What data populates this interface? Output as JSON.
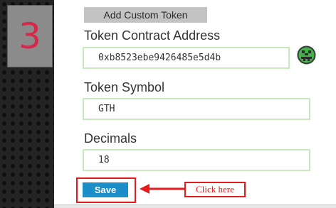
{
  "step": {
    "number": "3"
  },
  "form": {
    "header_label": "Add Custom Token",
    "contract_address": {
      "label": "Token Contract Address",
      "value": "0xb8523ebe9426485e5d4b",
      "icon": "identicon"
    },
    "symbol": {
      "label": "Token Symbol",
      "value": "GTH"
    },
    "decimals": {
      "label": "Decimals",
      "value": "18"
    },
    "save_label": "Save"
  },
  "annotation": {
    "callout_text": "Click here"
  },
  "colors": {
    "step_number": "#d6284b",
    "input_border": "#c8e8bd",
    "save_button": "#1b8ec9",
    "annotation": "#e31b1b"
  }
}
